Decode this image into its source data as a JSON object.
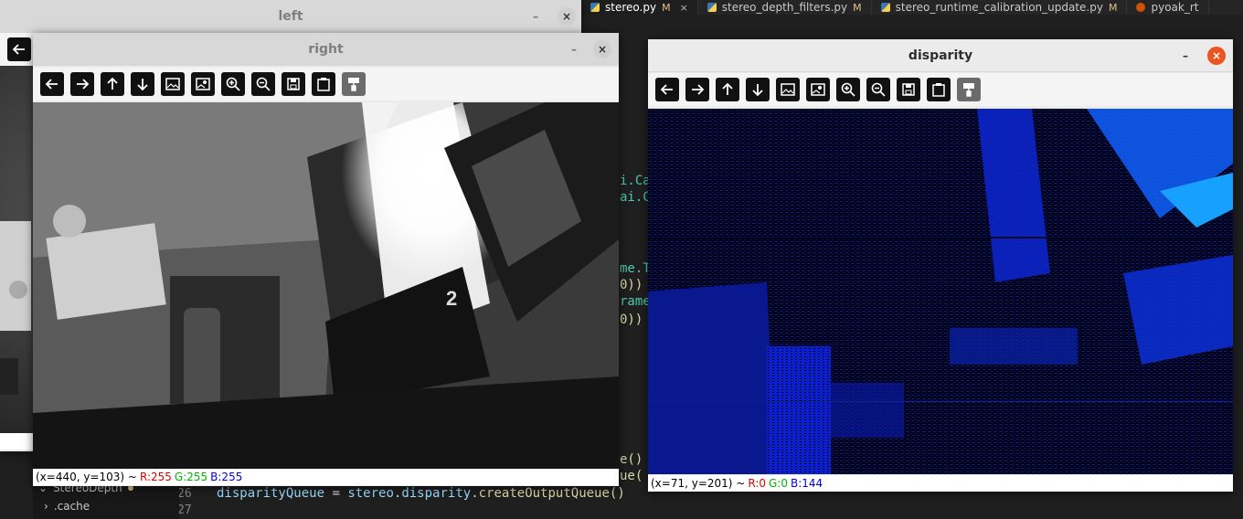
{
  "editor": {
    "tabs": [
      {
        "label": "stereo.py",
        "modified": "M",
        "active": true,
        "close": "×"
      },
      {
        "label": "stereo_depth_filters.py",
        "modified": "M",
        "active": false
      },
      {
        "label": "stereo_runtime_calibration_update.py",
        "modified": "M",
        "active": false
      },
      {
        "label": "pyoak_rt",
        "modified": "",
        "active": false
      }
    ],
    "code_fragments": [
      "i.Ca",
      "ai.C",
      "me.T",
      "0))",
      "rame",
      "0))",
      "e()",
      "ue("
    ],
    "line_26": "26",
    "line_27": "27",
    "line_26_code": {
      "a": "disparityQueue",
      "b": " = ",
      "c": "stereo",
      "d": ".",
      "e": "disparity",
      "f": ".",
      "g": "createOutputQueue",
      "h": "()"
    },
    "explorer": {
      "item1": "StereoDepth",
      "item2": ".cache"
    }
  },
  "windows": {
    "left": {
      "title": "left",
      "minimize": "–",
      "close": "×"
    },
    "right": {
      "title": "right",
      "minimize": "–",
      "close": "×",
      "status": {
        "coords": "(x=440, y=103) ~",
        "r": "R:255",
        "g": "G:255",
        "b": "B:255"
      }
    },
    "disparity": {
      "title": "disparity",
      "minimize": "–",
      "close": "×",
      "status": {
        "coords": "(x=71, y=201) ~",
        "r": "R:0",
        "g": "G:0",
        "b": "B:144"
      }
    }
  },
  "toolbar_icons": [
    "arrow-left-icon",
    "arrow-right-icon",
    "arrow-up-icon",
    "arrow-down-icon",
    "image-icon",
    "image-properties-icon",
    "zoom-in-icon",
    "zoom-out-icon",
    "save-icon",
    "clipboard-icon",
    "paint-roller-icon"
  ],
  "colors": {
    "accent_close": "#e95420",
    "status_r": "#e00000",
    "status_g": "#00b400",
    "status_b": "#0000e0",
    "disparity_blue": "#0a1fd0"
  }
}
